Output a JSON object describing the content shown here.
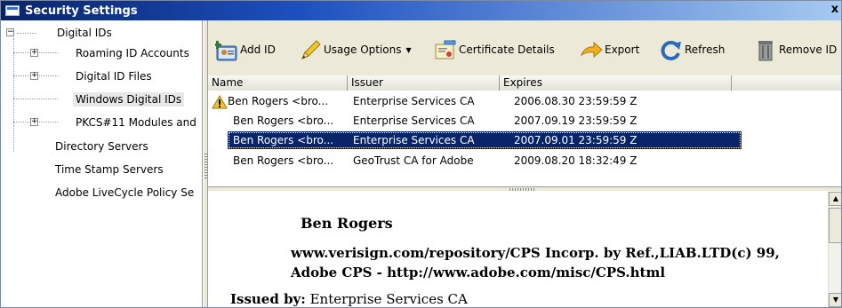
{
  "window": {
    "title": "Security Settings",
    "close_glyph": "x"
  },
  "tree": {
    "items": [
      {
        "label": "Digital IDs",
        "toggle": "−"
      },
      {
        "label": "Roaming ID Accounts",
        "toggle": "+"
      },
      {
        "label": "Digital ID Files",
        "toggle": "+"
      },
      {
        "label": "Windows Digital IDs"
      },
      {
        "label": "PKCS#11 Modules and",
        "toggle": "+"
      },
      {
        "label": "Directory Servers"
      },
      {
        "label": "Time Stamp Servers"
      },
      {
        "label": "Adobe LiveCycle Policy Se"
      }
    ]
  },
  "toolbar": {
    "add_id": "Add ID",
    "usage_options": "Usage Options",
    "certificate_details": "Certificate Details",
    "export": "Export",
    "refresh": "Refresh",
    "remove_id": "Remove ID"
  },
  "list": {
    "columns": [
      "Name",
      "Issuer",
      "Expires"
    ],
    "rows": [
      {
        "name": "Ben Rogers <bro...",
        "issuer": "Enterprise Services CA",
        "expires": "2006.08.30 23:59:59 Z",
        "warning": true
      },
      {
        "name": "Ben Rogers <bro...",
        "issuer": "Enterprise Services CA",
        "expires": "2007.09.19 23:59:59 Z"
      },
      {
        "name": "Ben Rogers <bro...",
        "issuer": "Enterprise Services CA",
        "expires": "2007.09.01 23:59:59 Z",
        "selected": true
      },
      {
        "name": "Ben Rogers <bro...",
        "issuer": "GeoTrust CA for Adobe",
        "expires": "2009.08.20 18:32:49 Z"
      }
    ]
  },
  "details": {
    "name": "Ben Rogers",
    "org_unit": "www.verisign.com/repository/CPS Incorp. by Ref.,LIAB.LTD(c) 99, Adobe CPS - http://www.adobe.com/misc/CPS.html",
    "issued_by_label": "Issued by:",
    "issued_by_value": "Enterprise Services CA"
  },
  "icons": {
    "add_id": "add-id-icon",
    "usage_options": "pencil-icon",
    "certificate_details": "certificate-icon",
    "export": "export-arrow-icon",
    "refresh": "refresh-icon",
    "remove_id": "trash-icon",
    "warning": "warning-icon"
  },
  "colors": {
    "titlebar_start": "#0a246a",
    "selection": "#0a246a",
    "toolbar_bg": "#ece9d8"
  }
}
